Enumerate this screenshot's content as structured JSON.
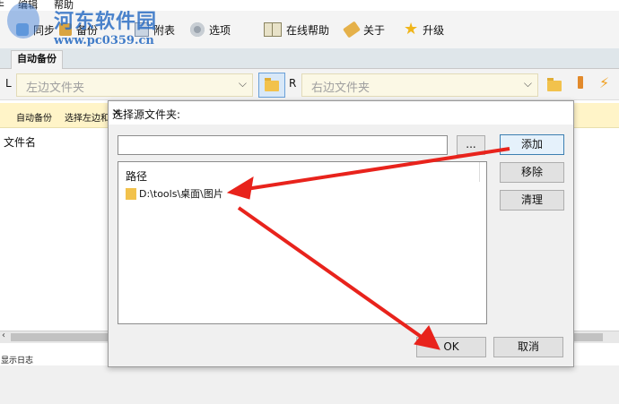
{
  "menu": {
    "left_glyph": "E",
    "edit": "编辑",
    "help": "帮助"
  },
  "toolbar": {
    "items": [
      {
        "label": "备份",
        "icon": "backup-icon"
      },
      {
        "label": "选项",
        "icon": "gear-icon"
      },
      {
        "label": "在线帮助",
        "icon": "book-icon"
      },
      {
        "label": "关于",
        "icon": "tag-icon"
      },
      {
        "label": "升级",
        "icon": "star-icon"
      }
    ],
    "partial_left": "同步",
    "partial_mid": "附表"
  },
  "watermark": {
    "title": "河东软件园",
    "url": "www.pc0359.cn"
  },
  "tabs": [
    {
      "label": "自动备份"
    }
  ],
  "paths": {
    "left_letter": "L",
    "left_placeholder": "左边文件夹",
    "right_letter": "R",
    "right_placeholder": "右边文件夹"
  },
  "infostrip": {
    "label1": "自动备份",
    "label2": "选择左边和"
  },
  "main": {
    "filename_header": "文件名"
  },
  "statusbar": {
    "text": "显示日志"
  },
  "dialog": {
    "title": "选择源文件夹:",
    "browse": "...",
    "add": "添加",
    "remove": "移除",
    "clear": "清理",
    "list_header": "路径",
    "items": [
      {
        "path": "D:\\tools\\桌面\\图片"
      }
    ],
    "ok": "OK",
    "cancel": "取消"
  },
  "colors": {
    "arrow": "#e8231c",
    "accent": "#3c7fb1"
  }
}
